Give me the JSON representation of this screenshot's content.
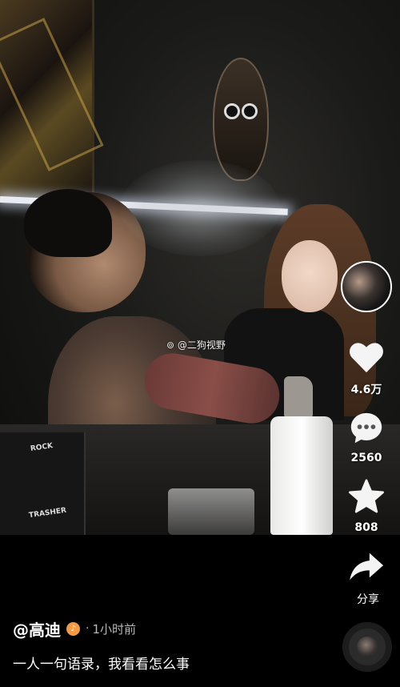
{
  "video": {
    "watermark": "@二狗视野",
    "props": {
      "cabinet_labels": [
        "ROCK",
        "TRASHER"
      ]
    }
  },
  "sidebar": {
    "like_count": "4.6万",
    "comment_count": "2560",
    "favorite_count": "808",
    "share_label": "分享"
  },
  "author": {
    "name": "@高迪",
    "separator": "·",
    "time": "1小时前",
    "badge_color": "#f29a45"
  },
  "caption": "一人一句语录，我看看怎么事"
}
